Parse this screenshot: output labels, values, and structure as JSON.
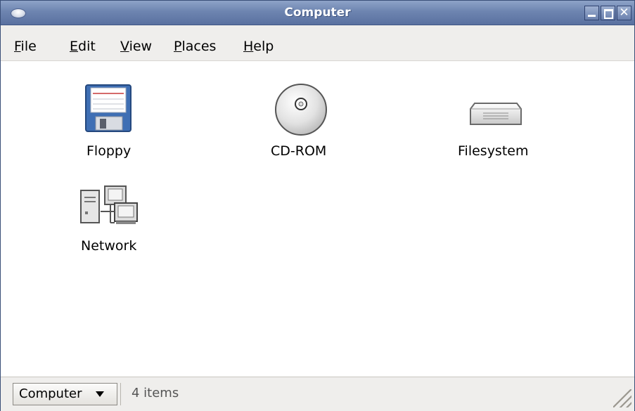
{
  "window": {
    "title": "Computer"
  },
  "menubar": {
    "items": [
      {
        "mnemonic": "F",
        "rest": "ile"
      },
      {
        "mnemonic": "E",
        "rest": "dit"
      },
      {
        "mnemonic": "V",
        "rest": "iew"
      },
      {
        "mnemonic": "P",
        "rest": "laces"
      },
      {
        "mnemonic": "H",
        "rest": "elp"
      }
    ]
  },
  "content": {
    "items": [
      {
        "label": "Floppy",
        "icon": "floppy-icon"
      },
      {
        "label": "CD-ROM",
        "icon": "cdrom-icon"
      },
      {
        "label": "Filesystem",
        "icon": "harddisk-icon"
      },
      {
        "label": "Network",
        "icon": "network-icon"
      }
    ]
  },
  "statusbar": {
    "location": "Computer",
    "count": "4 items"
  },
  "colors": {
    "titlebar": "#6d84b0",
    "background": "#ffffff",
    "chrome": "#efeeec"
  }
}
